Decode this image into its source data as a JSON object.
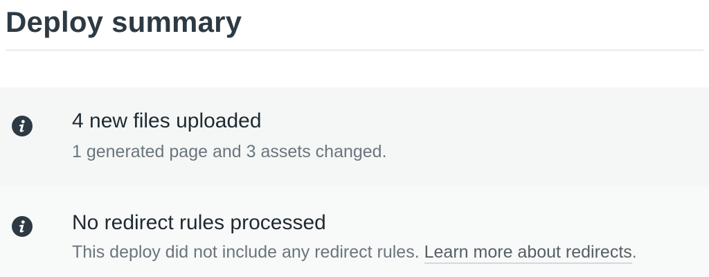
{
  "header": {
    "title": "Deploy summary"
  },
  "items": [
    {
      "icon": "info-icon",
      "heading": "4 new files uploaded",
      "description": "1 generated page and 3 assets changed."
    },
    {
      "icon": "info-icon",
      "heading": "No redirect rules processed",
      "description": "This deploy did not include any redirect rules.",
      "link_text": "Learn more about redirects",
      "trailing_text": "."
    }
  ],
  "colors": {
    "heading_text": "#1f2a30",
    "muted_text": "#6a757c",
    "icon_fill": "#2e3a43",
    "row_background": "#f5f7f7"
  }
}
